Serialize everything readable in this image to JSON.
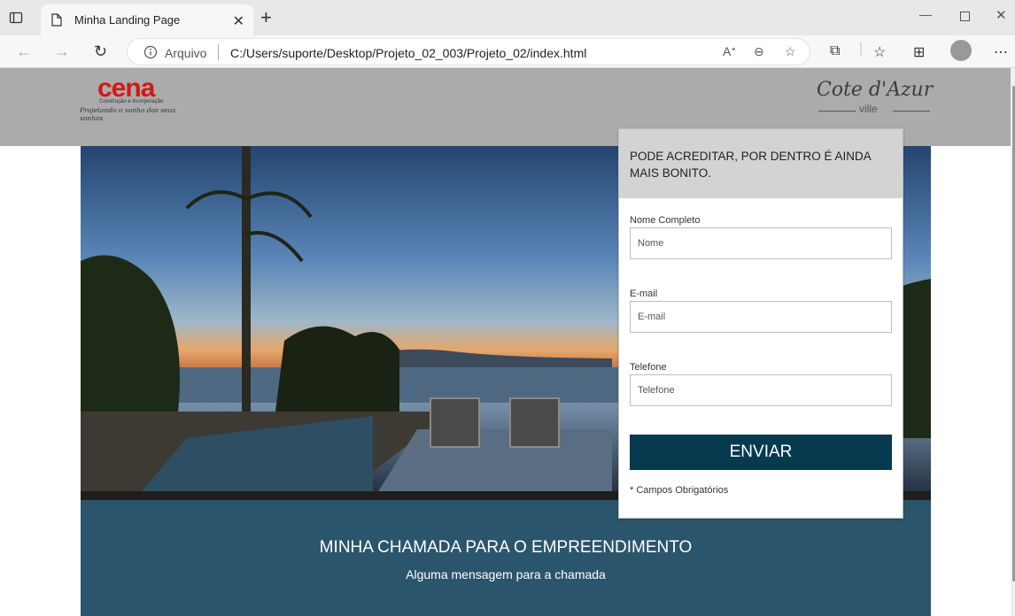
{
  "browser": {
    "tab_title": "Minha Landing Page",
    "scheme_label": "Arquivo",
    "url": "C:/Users/suporte/Desktop/Projeto_02_003/Projeto_02/index.html",
    "icons": [
      "tab-actions-icon",
      "page-icon",
      "close-icon",
      "plus-icon",
      "minimize-icon",
      "maximize-icon",
      "close-window-icon",
      "back-icon",
      "forward-icon",
      "refresh-icon",
      "info-icon",
      "read-aloud-icon",
      "zoom-out-icon",
      "add-favorite-icon",
      "extensions-icon",
      "favorites-icon",
      "collections-icon",
      "profile-icon",
      "more-icon"
    ]
  },
  "header": {
    "logo_left": {
      "word": "cena",
      "sub": "Construção e Incorporação",
      "tagline": "Projetando o sonho dos seus sonhos"
    },
    "logo_right": {
      "word": "Cote d'Azur",
      "sub": "ville"
    }
  },
  "form": {
    "heading": "PODE ACREDITAR, POR DENTRO É AINDA MAIS BONITO.",
    "fields": [
      {
        "label": "Nome Completo",
        "placeholder": "Nome"
      },
      {
        "label": "E-mail",
        "placeholder": "E-mail"
      },
      {
        "label": "Telefone",
        "placeholder": "Telefone"
      }
    ],
    "submit_label": "ENVIAR",
    "required_note": "* Campos Obrigatórios"
  },
  "band": {
    "headline": "MINHA CHAMADA PARA O EMPREENDIMENTO",
    "message": "Alguma mensagem para a chamada"
  },
  "colors": {
    "header_bg": "#ababab",
    "band_bg": "#2a556c",
    "button_bg": "#073a4e",
    "logo_red": "#d21818"
  }
}
